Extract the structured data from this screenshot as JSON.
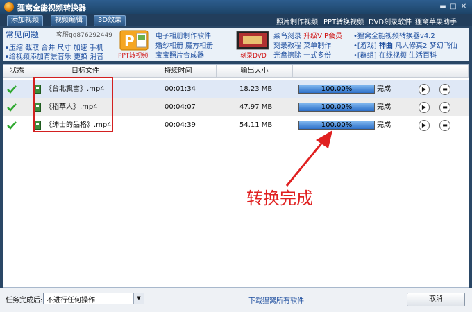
{
  "app": {
    "title": "狸窝全能视频转换器"
  },
  "toolbar": {
    "add_video": "添加视频",
    "edit_video": "视频编辑",
    "effect_3d": "3D效果",
    "links": [
      "照片制作视频",
      "PPT转换视频",
      "DVD刻录软件",
      "狸窝苹果助手"
    ]
  },
  "ad": {
    "faq_title": "常见问题",
    "qq": "客服qq876292449",
    "left_lines": [
      "•压缩 截取 合并 尺寸 加速 手机",
      "•给视频添加背景音乐 更换 消音"
    ],
    "ppt_label": "PPT转视频",
    "ppt_links": [
      "电子相册制作软件",
      "婚纱相册 魔方相册",
      "宝宝照片合成器"
    ],
    "dvd_label": "刻录DVD",
    "dvd_links_a": [
      "菜鸟刻录",
      "升级VIP会员"
    ],
    "dvd_links_b": [
      "刻录教程",
      "菜单制作"
    ],
    "dvd_links_c": [
      "光盘擦除",
      "一式多份"
    ],
    "right_line1": "•狸窝全能视频转换器v4.2",
    "right_line2_prefix": "•[游戏]",
    "right_line2_hot": "神曲",
    "right_line2_rest": "凡人修真2 梦幻飞仙",
    "right_line3": "•[群组] 在线视频 生活百科"
  },
  "table": {
    "headers": {
      "status": "状态",
      "target": "目标文件",
      "duration": "持续时间",
      "size": "输出大小"
    },
    "rows": [
      {
        "file": "《台北飘雪》.mp4",
        "duration": "00:01:34",
        "size": "18.23 MB",
        "progress": "100.00%",
        "status": "完成"
      },
      {
        "file": "《稻草人》.mp4",
        "duration": "00:04:07",
        "size": "47.97 MB",
        "progress": "100.00%",
        "status": "完成"
      },
      {
        "file": "《绅士的品格》.mp4",
        "duration": "00:04:39",
        "size": "54.11 MB",
        "progress": "100.00%",
        "status": "完成"
      }
    ]
  },
  "annotation": {
    "text": "转换完成"
  },
  "bottom": {
    "after_label": "任务完成后:",
    "after_value": "不进行任何操作",
    "download_link": "下载狸窝所有软件",
    "cancel": "取消"
  },
  "colors": {
    "annotation": "#e02020",
    "progress_fill": "#2c6fc8",
    "title_bar": "#1d4468"
  }
}
